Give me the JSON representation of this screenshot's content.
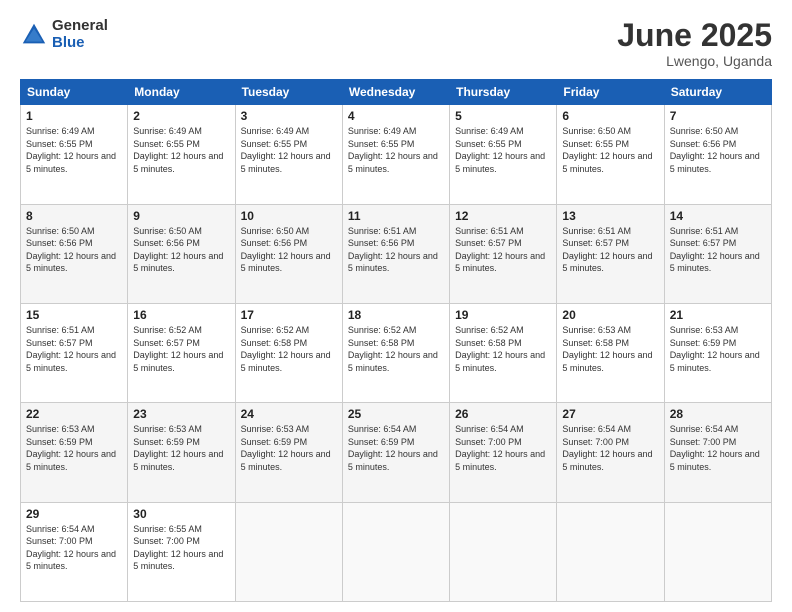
{
  "logo": {
    "general": "General",
    "blue": "Blue"
  },
  "title": {
    "month": "June 2025",
    "location": "Lwengo, Uganda"
  },
  "days_header": [
    "Sunday",
    "Monday",
    "Tuesday",
    "Wednesday",
    "Thursday",
    "Friday",
    "Saturday"
  ],
  "weeks": [
    [
      {
        "day": "1",
        "sunrise": "6:49 AM",
        "sunset": "6:55 PM",
        "daylight": "12 hours and 5 minutes."
      },
      {
        "day": "2",
        "sunrise": "6:49 AM",
        "sunset": "6:55 PM",
        "daylight": "12 hours and 5 minutes."
      },
      {
        "day": "3",
        "sunrise": "6:49 AM",
        "sunset": "6:55 PM",
        "daylight": "12 hours and 5 minutes."
      },
      {
        "day": "4",
        "sunrise": "6:49 AM",
        "sunset": "6:55 PM",
        "daylight": "12 hours and 5 minutes."
      },
      {
        "day": "5",
        "sunrise": "6:49 AM",
        "sunset": "6:55 PM",
        "daylight": "12 hours and 5 minutes."
      },
      {
        "day": "6",
        "sunrise": "6:50 AM",
        "sunset": "6:55 PM",
        "daylight": "12 hours and 5 minutes."
      },
      {
        "day": "7",
        "sunrise": "6:50 AM",
        "sunset": "6:56 PM",
        "daylight": "12 hours and 5 minutes."
      }
    ],
    [
      {
        "day": "8",
        "sunrise": "6:50 AM",
        "sunset": "6:56 PM",
        "daylight": "12 hours and 5 minutes."
      },
      {
        "day": "9",
        "sunrise": "6:50 AM",
        "sunset": "6:56 PM",
        "daylight": "12 hours and 5 minutes."
      },
      {
        "day": "10",
        "sunrise": "6:50 AM",
        "sunset": "6:56 PM",
        "daylight": "12 hours and 5 minutes."
      },
      {
        "day": "11",
        "sunrise": "6:51 AM",
        "sunset": "6:56 PM",
        "daylight": "12 hours and 5 minutes."
      },
      {
        "day": "12",
        "sunrise": "6:51 AM",
        "sunset": "6:57 PM",
        "daylight": "12 hours and 5 minutes."
      },
      {
        "day": "13",
        "sunrise": "6:51 AM",
        "sunset": "6:57 PM",
        "daylight": "12 hours and 5 minutes."
      },
      {
        "day": "14",
        "sunrise": "6:51 AM",
        "sunset": "6:57 PM",
        "daylight": "12 hours and 5 minutes."
      }
    ],
    [
      {
        "day": "15",
        "sunrise": "6:51 AM",
        "sunset": "6:57 PM",
        "daylight": "12 hours and 5 minutes."
      },
      {
        "day": "16",
        "sunrise": "6:52 AM",
        "sunset": "6:57 PM",
        "daylight": "12 hours and 5 minutes."
      },
      {
        "day": "17",
        "sunrise": "6:52 AM",
        "sunset": "6:58 PM",
        "daylight": "12 hours and 5 minutes."
      },
      {
        "day": "18",
        "sunrise": "6:52 AM",
        "sunset": "6:58 PM",
        "daylight": "12 hours and 5 minutes."
      },
      {
        "day": "19",
        "sunrise": "6:52 AM",
        "sunset": "6:58 PM",
        "daylight": "12 hours and 5 minutes."
      },
      {
        "day": "20",
        "sunrise": "6:53 AM",
        "sunset": "6:58 PM",
        "daylight": "12 hours and 5 minutes."
      },
      {
        "day": "21",
        "sunrise": "6:53 AM",
        "sunset": "6:59 PM",
        "daylight": "12 hours and 5 minutes."
      }
    ],
    [
      {
        "day": "22",
        "sunrise": "6:53 AM",
        "sunset": "6:59 PM",
        "daylight": "12 hours and 5 minutes."
      },
      {
        "day": "23",
        "sunrise": "6:53 AM",
        "sunset": "6:59 PM",
        "daylight": "12 hours and 5 minutes."
      },
      {
        "day": "24",
        "sunrise": "6:53 AM",
        "sunset": "6:59 PM",
        "daylight": "12 hours and 5 minutes."
      },
      {
        "day": "25",
        "sunrise": "6:54 AM",
        "sunset": "6:59 PM",
        "daylight": "12 hours and 5 minutes."
      },
      {
        "day": "26",
        "sunrise": "6:54 AM",
        "sunset": "7:00 PM",
        "daylight": "12 hours and 5 minutes."
      },
      {
        "day": "27",
        "sunrise": "6:54 AM",
        "sunset": "7:00 PM",
        "daylight": "12 hours and 5 minutes."
      },
      {
        "day": "28",
        "sunrise": "6:54 AM",
        "sunset": "7:00 PM",
        "daylight": "12 hours and 5 minutes."
      }
    ],
    [
      {
        "day": "29",
        "sunrise": "6:54 AM",
        "sunset": "7:00 PM",
        "daylight": "12 hours and 5 minutes."
      },
      {
        "day": "30",
        "sunrise": "6:55 AM",
        "sunset": "7:00 PM",
        "daylight": "12 hours and 5 minutes."
      },
      null,
      null,
      null,
      null,
      null
    ]
  ]
}
